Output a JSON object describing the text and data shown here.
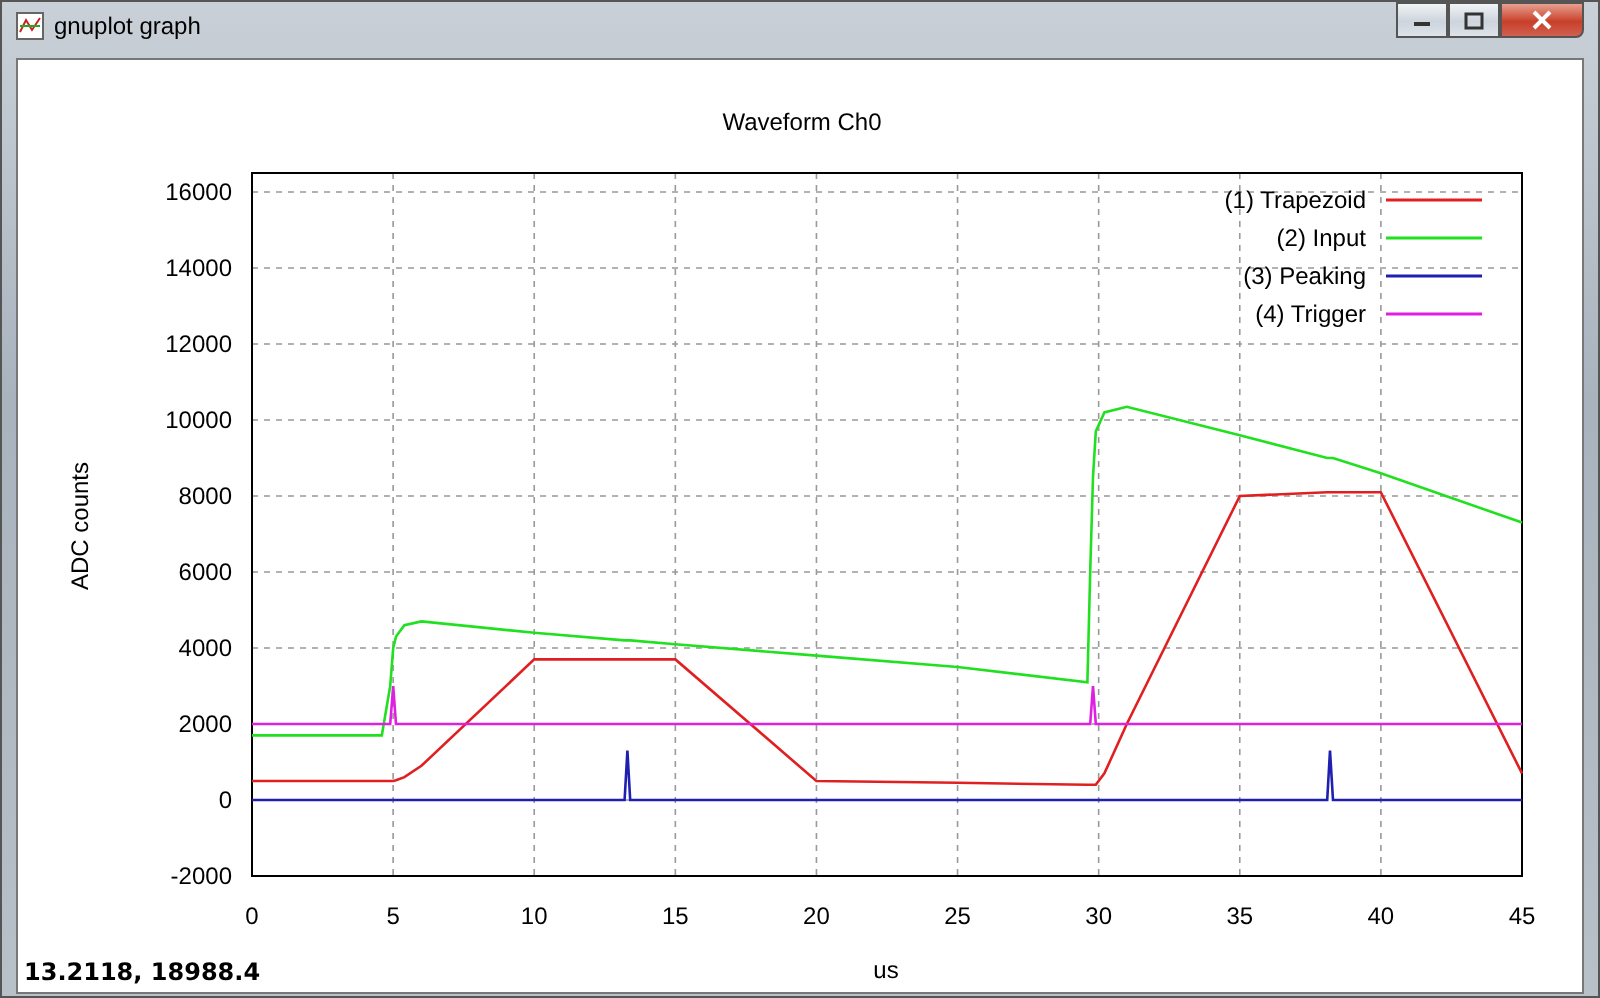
{
  "window": {
    "title": "gnuplot graph"
  },
  "plot": {
    "chart_data": {
      "type": "line",
      "title": "Waveform Ch0",
      "xlabel": "us",
      "ylabel": "ADC counts",
      "x": [
        0,
        4.6,
        4.9,
        5.0,
        5.1,
        5.4,
        6,
        10,
        13.2,
        13.3,
        13.4,
        15,
        20,
        25,
        29.6,
        29.7,
        29.8,
        29.9,
        30.2,
        31,
        35,
        38.1,
        38.2,
        38.3,
        40,
        45
      ],
      "series": [
        {
          "name": "(1) Trapezoid",
          "color": "#e02020",
          "values": [
            500,
            500,
            500,
            500,
            520,
            600,
            900,
            3700,
            3700,
            3700,
            3700,
            3700,
            500,
            450,
            400,
            400,
            400,
            400,
            700,
            2000,
            8000,
            8100,
            8100,
            8100,
            8100,
            700
          ]
        },
        {
          "name": "(2) Input",
          "color": "#20e020",
          "values": [
            1700,
            1700,
            3000,
            4000,
            4300,
            4600,
            4700,
            4400,
            4200,
            4200,
            4200,
            4100,
            3800,
            3500,
            3100,
            6000,
            8500,
            9700,
            10200,
            10350,
            9600,
            9000,
            9000,
            9000,
            8600,
            7300
          ]
        },
        {
          "name": "(3) Peaking",
          "color": "#2020b0",
          "values": [
            0,
            0,
            0,
            0,
            0,
            0,
            0,
            0,
            0,
            1300,
            0,
            0,
            0,
            0,
            0,
            0,
            0,
            0,
            0,
            0,
            0,
            0,
            1300,
            0,
            0,
            0
          ]
        },
        {
          "name": "(4) Trigger",
          "color": "#e020e0",
          "values": [
            2000,
            2000,
            2000,
            3000,
            2000,
            2000,
            2000,
            2000,
            2000,
            2000,
            2000,
            2000,
            2000,
            2000,
            2000,
            2000,
            3000,
            2000,
            2000,
            2000,
            2000,
            2000,
            2000,
            2000,
            2000,
            2000
          ]
        }
      ],
      "xlim": [
        0,
        45
      ],
      "ylim": [
        -2000,
        16500
      ],
      "xticks": [
        0,
        5,
        10,
        15,
        20,
        25,
        30,
        35,
        40,
        45
      ],
      "yticks": [
        -2000,
        0,
        2000,
        4000,
        6000,
        8000,
        10000,
        12000,
        14000,
        16000
      ],
      "grid": true,
      "legend": true
    }
  },
  "status_bar": {
    "text": "13.2118, 18988.4"
  }
}
